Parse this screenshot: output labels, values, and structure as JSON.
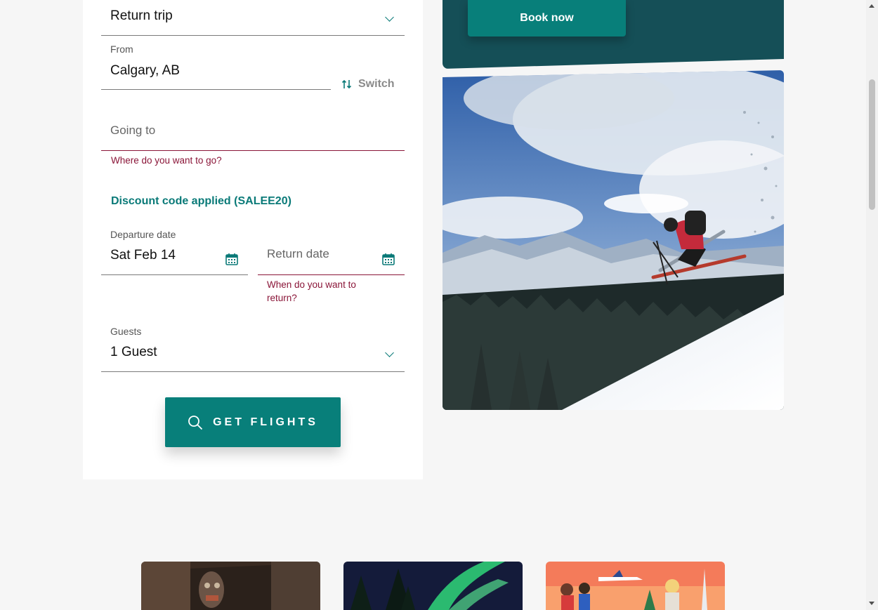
{
  "form": {
    "trip_type": {
      "value": "Return trip"
    },
    "from": {
      "label": "From",
      "value": "Calgary, AB"
    },
    "switch_label": "Switch",
    "going_to": {
      "placeholder": "Going to",
      "error": "Where do you want to go?"
    },
    "discount_text": "Discount code applied (SALEE20)",
    "departure": {
      "label": "Departure date",
      "value": "Sat Feb 14"
    },
    "return": {
      "placeholder": "Return date",
      "error_line1": "When do you want to",
      "error_line2": "return?"
    },
    "guests": {
      "label": "Guests",
      "value": "1 Guest"
    },
    "submit_label": "GET FLIGHTS"
  },
  "promo": {
    "book_label": "Book now"
  },
  "colors": {
    "accent": "#087f7a",
    "dark_teal": "#154f57",
    "error": "#8a1538",
    "background": "#f6f6f6"
  },
  "icons": [
    "chevron-down-icon",
    "switch-icon",
    "calendar-icon",
    "search-icon"
  ]
}
